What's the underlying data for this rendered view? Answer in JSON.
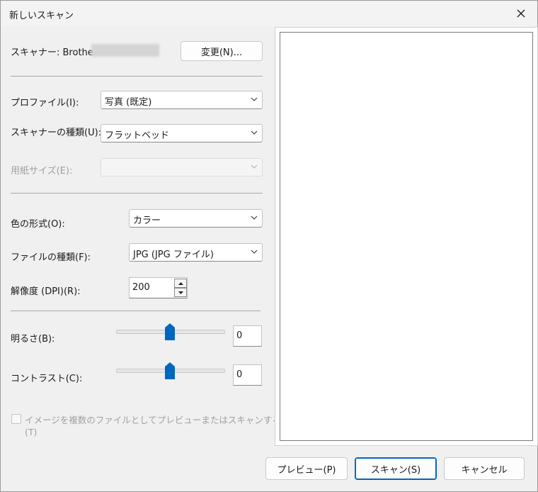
{
  "window": {
    "title": "新しいスキャン"
  },
  "scanner": {
    "label": "スキャナー: Brother",
    "change_button": "変更(N)..."
  },
  "profile": {
    "label": "プロファイル(I):",
    "value": "写真 (既定)"
  },
  "scanner_type": {
    "label": "スキャナーの種類(U):",
    "value": "フラットベッド"
  },
  "paper_size": {
    "label": "用紙サイズ(E):",
    "value": ""
  },
  "color_format": {
    "label": "色の形式(O):",
    "value": "カラー"
  },
  "file_type": {
    "label": "ファイルの種類(F):",
    "value": "JPG (JPG ファイル)"
  },
  "resolution": {
    "label": "解像度 (DPI)(R):",
    "value": "200"
  },
  "brightness": {
    "label": "明るさ(B):",
    "value": "0",
    "level": 0.5
  },
  "contrast": {
    "label": "コントラスト(C):",
    "value": "0",
    "level": 0.5
  },
  "multi_file": {
    "label_line1": "イメージを複数のファイルとしてプレビューまたはスキャンする",
    "label_line2": "(T)",
    "checked": false
  },
  "buttons": {
    "preview": "プレビュー(P)",
    "scan": "スキャン(S)",
    "cancel": "キャンセル"
  },
  "colors": {
    "accent": "#0067c0"
  }
}
